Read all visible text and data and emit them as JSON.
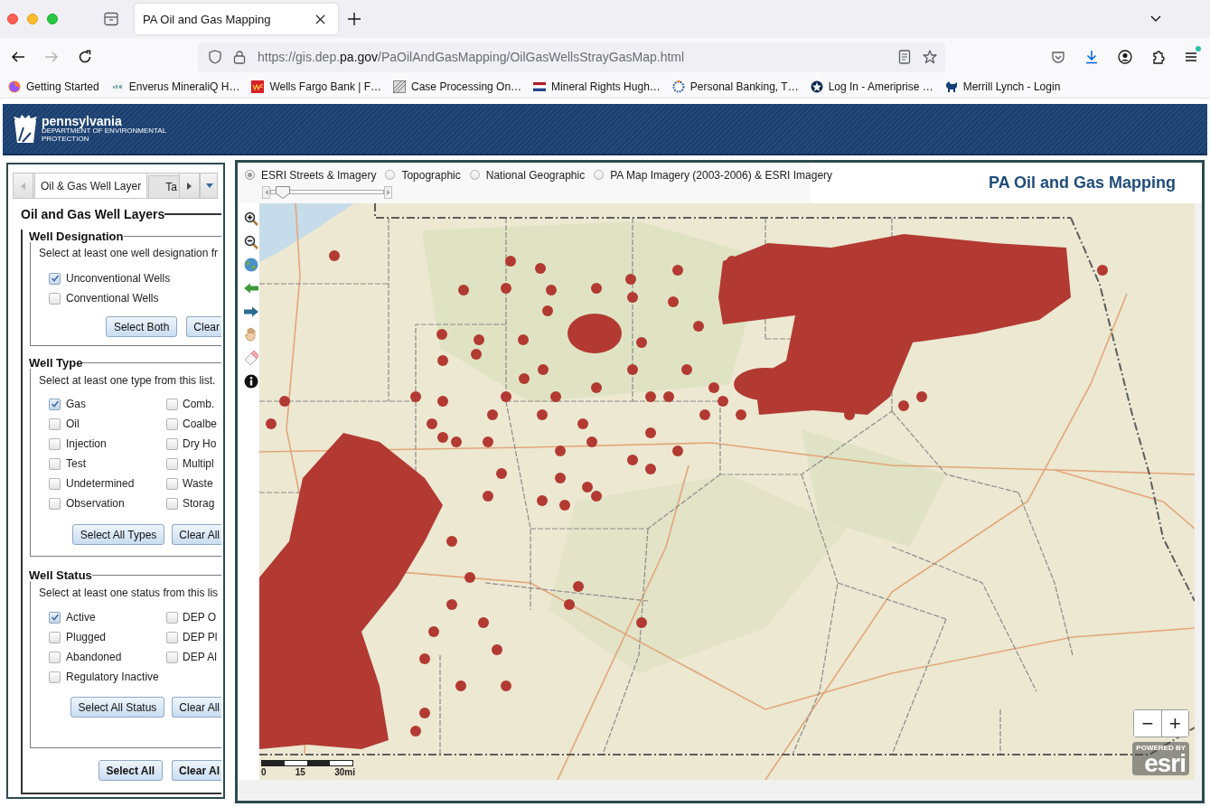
{
  "browser": {
    "tab_title": "PA Oil and Gas Mapping",
    "nav_buttons": [
      {
        "kind": "back",
        "disabled": false
      },
      {
        "kind": "forward",
        "disabled": true
      },
      {
        "kind": "reload",
        "disabled": false
      }
    ],
    "url": {
      "prefix": "https://gis.dep.",
      "domain": "pa.gov",
      "path": "/PaOilAndGasMapping/OilGasWellsStrayGasMap.html"
    },
    "bookmarks": [
      "Getting Started",
      "Enverus MineraliQ H…",
      "Wells Fargo Bank | F…",
      "Case Processing On…",
      "Mineral Rights Hugh…",
      "Personal Banking, T…",
      "Log In - Ameriprise …",
      "Merrill Lynch - Login"
    ]
  },
  "header": {
    "state": "pennsylvania",
    "department": [
      "DEPARTMENT OF ENVIRONMENTAL",
      "PROTECTION"
    ]
  },
  "layer_panel": {
    "tabs": [
      {
        "label": "Oil & Gas Well Layer",
        "selected": true
      },
      {
        "label": "Ta",
        "selected": false
      }
    ],
    "title": "Oil and Gas Well Layers",
    "groups": [
      {
        "title": "Well Designation",
        "hint": "Select at least one well designation fr",
        "columns": [
          [
            {
              "label": "Unconventional Wells",
              "checked": true
            },
            {
              "label": "Conventional Wells",
              "checked": false
            }
          ]
        ],
        "buttons": [
          "Select Both",
          "Clear"
        ]
      },
      {
        "title": "Well Type",
        "hint": "Select at least one type from this list.",
        "columns": [
          [
            {
              "label": "Gas",
              "checked": true
            },
            {
              "label": "Oil",
              "checked": false
            },
            {
              "label": "Injection",
              "checked": false
            },
            {
              "label": "Test",
              "checked": false
            },
            {
              "label": "Undetermined",
              "checked": false
            },
            {
              "label": "Observation",
              "checked": false
            }
          ],
          [
            {
              "label": "Comb.",
              "checked": false
            },
            {
              "label": "Coalbe",
              "checked": false
            },
            {
              "label": "Dry Ho",
              "checked": false
            },
            {
              "label": "Multipl",
              "checked": false
            },
            {
              "label": "Waste",
              "checked": false
            },
            {
              "label": "Storag",
              "checked": false
            }
          ]
        ],
        "buttons": [
          "Select All Types",
          "Clear All"
        ]
      },
      {
        "title": "Well Status",
        "hint": "Select at least one status from this lis",
        "columns": [
          [
            {
              "label": "Active",
              "checked": true
            },
            {
              "label": "Plugged",
              "checked": false
            },
            {
              "label": "Abandoned",
              "checked": false
            },
            {
              "label": "Regulatory Inactive",
              "checked": false
            }
          ],
          [
            {
              "label": "DEP O",
              "checked": false
            },
            {
              "label": "DEP Pl",
              "checked": false
            },
            {
              "label": "DEP Al",
              "checked": false
            }
          ]
        ],
        "buttons": [
          "Select All Status",
          "Clear All"
        ]
      }
    ],
    "buttons": [
      "Select All",
      "Clear Al"
    ]
  },
  "map": {
    "basemaps": [
      {
        "label": "ESRI Streets & Imagery",
        "selected": true
      },
      {
        "label": "Topographic",
        "selected": false
      },
      {
        "label": "National Geographic",
        "selected": false
      },
      {
        "label": "PA Map Imagery (2003-2006) & ESRI Imagery",
        "selected": false
      }
    ],
    "transparency_slider": {
      "level": 0.05
    },
    "title": "PA Oil and Gas Mapping",
    "zoom_buttons": [
      "−",
      "+"
    ],
    "scale_labels": [
      "0",
      "15",
      "30mi"
    ],
    "attribution": {
      "caption": "POWERED BY",
      "logo": "esri"
    }
  }
}
